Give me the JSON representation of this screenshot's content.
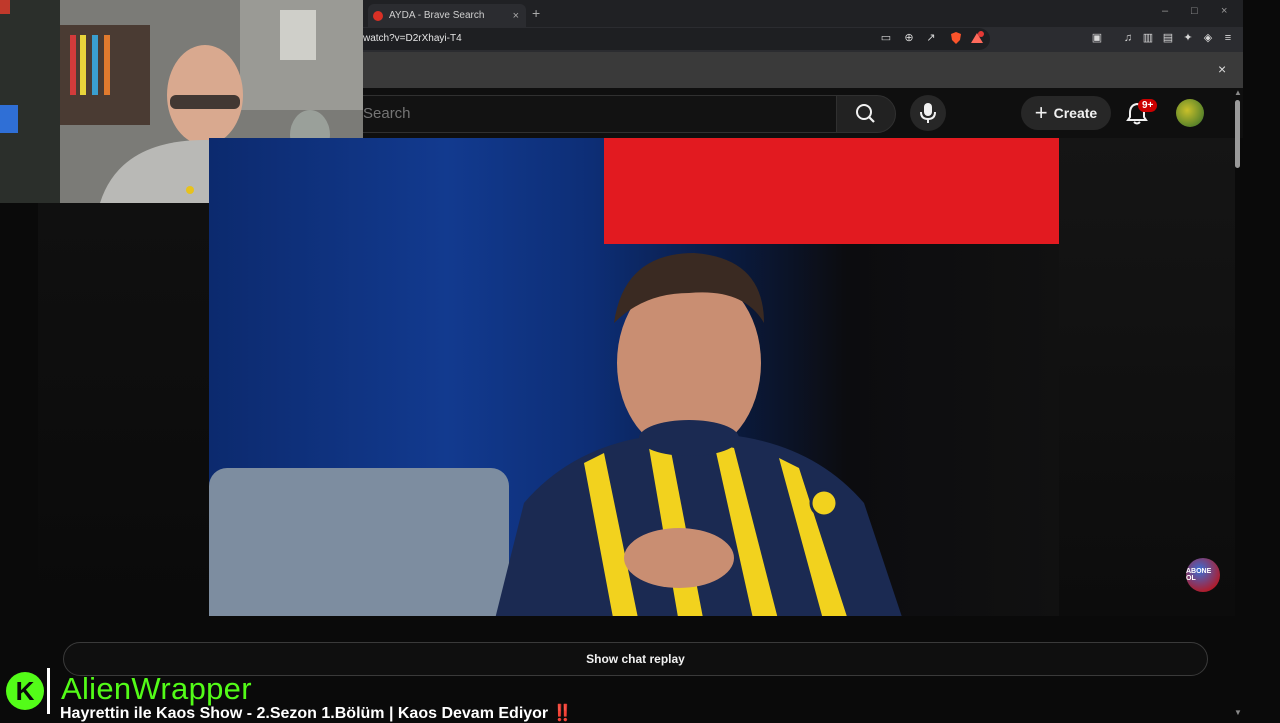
{
  "browser": {
    "tab_title": "AYDA - Brave Search",
    "new_tab": "+",
    "tab_close": "×",
    "window_controls": [
      "–",
      "□",
      "×"
    ],
    "url": "watch?v=D2rXhayi-T4",
    "shields_count": "",
    "infobar_close": "×"
  },
  "youtube": {
    "search_placeholder": "Search",
    "create_label": "Create",
    "notifications_badge": "9+",
    "show_chat_replay": "Show chat replay",
    "subscribe_badge": "ABONE OL"
  },
  "overlay": {
    "kick_logo": "K",
    "channel_name": "AlienWrapper",
    "stream_title": "Hayrettin ile Kaos Show - 2.Sezon 1.Bölüm | Kaos Devam Ediyor",
    "title_mark": "‼️"
  },
  "colors": {
    "kick_green": "#53fc18",
    "youtube_bg": "#0f0f0f",
    "notification_red": "#cc0000"
  }
}
